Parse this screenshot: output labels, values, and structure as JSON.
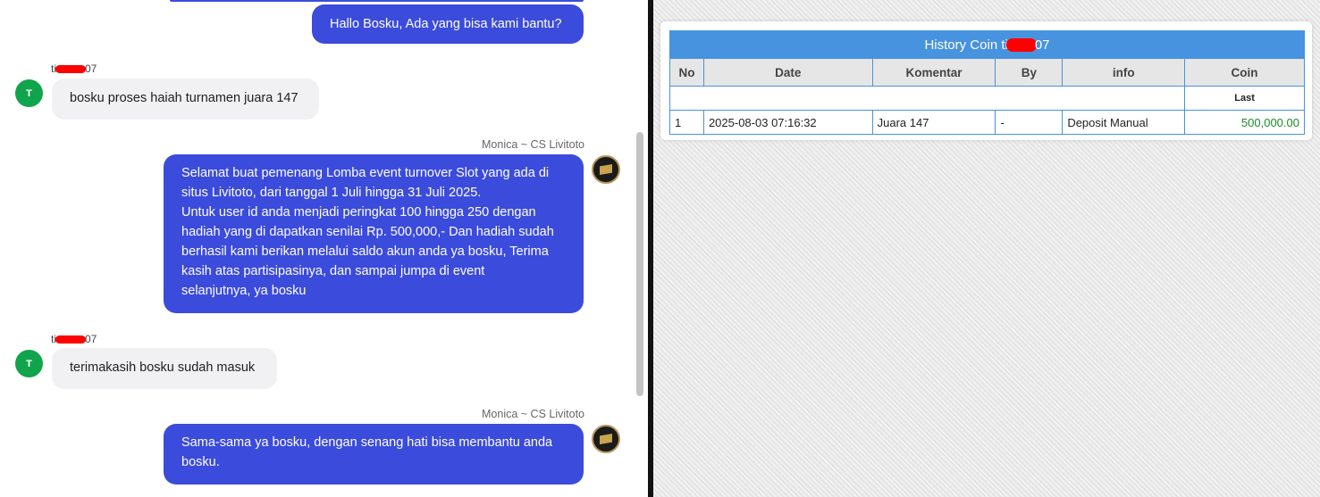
{
  "chat": {
    "messages": [
      {
        "role": "agent",
        "text": "Hallo Bosku, Ada yang bisa kami bantu?"
      },
      {
        "role": "user",
        "sender_prefix": "ti",
        "sender_suffix": "07",
        "avatar_letter": "T",
        "text": "bosku proses haiah turnamen juara 147"
      },
      {
        "role": "agent",
        "sender": "Monica ~ CS Livitoto",
        "lines": [
          "Selamat buat pemenang Lomba event turnover Slot yang ada di",
          "situs Livitoto, dari tanggal 1 Juli hingga 31 Juli 2025.",
          "Untuk user id anda menjadi peringkat 100 hingga 250 dengan",
          "hadiah yang di dapatkan senilai Rp. 500,000,- Dan hadiah sudah",
          "berhasil kami berikan melalui saldo akun anda ya bosku, Terima",
          "kasih atas partisipasinya, dan sampai jumpa di event",
          "selanjutnya, ya bosku"
        ]
      },
      {
        "role": "user",
        "sender_prefix": "ti",
        "sender_suffix": "07",
        "avatar_letter": "T",
        "text": "terimakasih bosku sudah masuk"
      },
      {
        "role": "agent",
        "sender": "Monica ~ CS Livitoto",
        "lines": [
          "Sama-sama ya bosku, dengan senang hati bisa membantu anda",
          "bosku."
        ]
      }
    ]
  },
  "history": {
    "title_prefix": "History Coin ti",
    "title_suffix": "07",
    "columns": [
      "No",
      "Date",
      "Komentar",
      "By",
      "info",
      "Coin"
    ],
    "last_label": "Last",
    "rows": [
      {
        "no": "1",
        "date": "2025-08-03 07:16:32",
        "komentar": "Juara 147",
        "by": "-",
        "info": "Deposit Manual",
        "coin": "500,000.00"
      }
    ],
    "coin_color": "#1a8a2e",
    "header_color": "#4793df"
  },
  "colors": {
    "agent_bubble": "#3b4bdc",
    "user_bubble": "#f1f1f3",
    "user_avatar": "#10a54c"
  }
}
